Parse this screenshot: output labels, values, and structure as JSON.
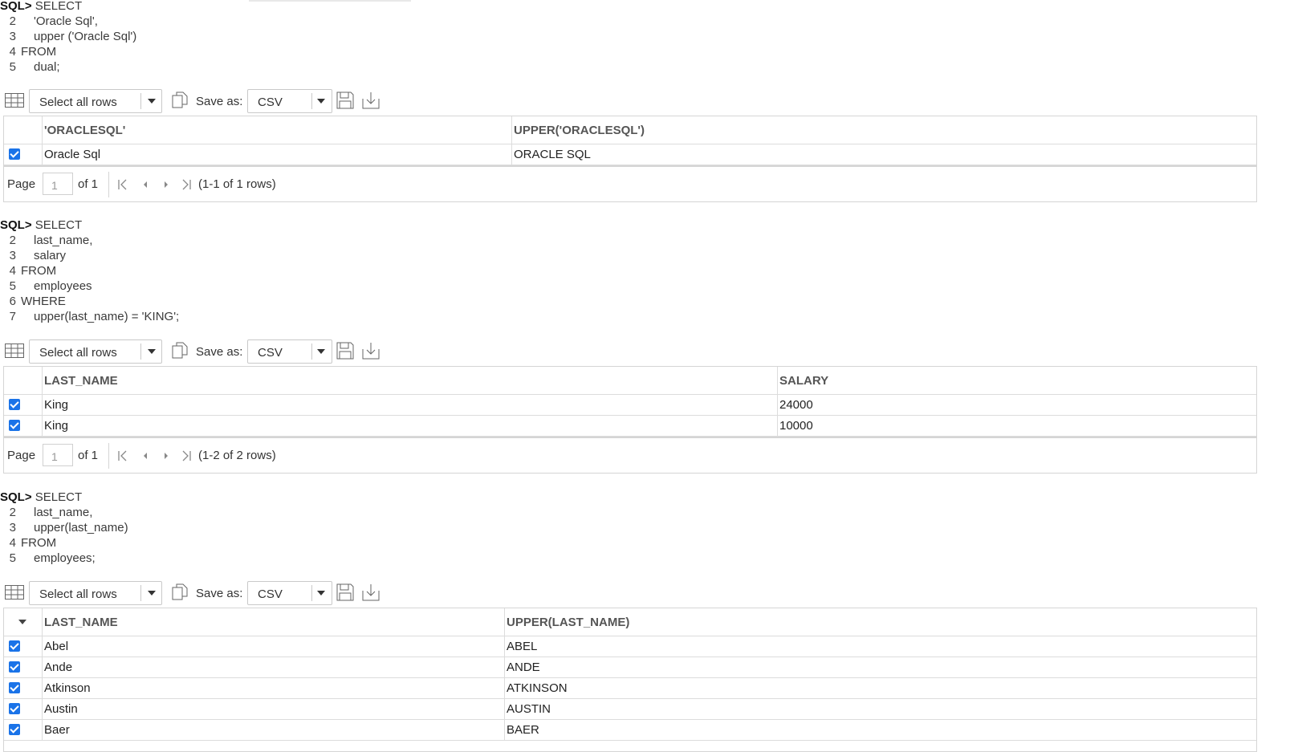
{
  "toolbar": {
    "select_label": "Select all rows",
    "save_as_label": "Save as:",
    "format_value": "CSV"
  },
  "pager": {
    "page_label": "Page",
    "of_label": "of 1",
    "page_value": "1"
  },
  "query1": {
    "prompt": "SQL>",
    "lines": [
      {
        "num": "",
        "text": "SELECT"
      },
      {
        "num": "2",
        "text": "'Oracle Sql',"
      },
      {
        "num": "3",
        "text": "upper ('Oracle Sql')"
      },
      {
        "num": "4",
        "text": "FROM"
      },
      {
        "num": "5",
        "text": "dual;"
      }
    ],
    "columns": [
      "'ORACLESQL'",
      "UPPER('ORACLESQL')"
    ],
    "rows": [
      [
        "Oracle Sql",
        "ORACLE SQL"
      ]
    ],
    "row_info": "(1-1 of 1 rows)"
  },
  "query2": {
    "prompt": "SQL>",
    "lines": [
      {
        "num": "",
        "text": "SELECT"
      },
      {
        "num": "2",
        "text": "last_name,"
      },
      {
        "num": "3",
        "text": "salary"
      },
      {
        "num": "4",
        "text": "FROM"
      },
      {
        "num": "5",
        "text": "employees"
      },
      {
        "num": "6",
        "text": "WHERE"
      },
      {
        "num": "7",
        "text": "upper(last_name) = 'KING';"
      }
    ],
    "columns": [
      "LAST_NAME",
      "SALARY"
    ],
    "rows": [
      [
        "King",
        "24000"
      ],
      [
        "King",
        "10000"
      ]
    ],
    "row_info": "(1-2 of 2 rows)"
  },
  "query3": {
    "prompt": "SQL>",
    "lines": [
      {
        "num": "",
        "text": "SELECT"
      },
      {
        "num": "2",
        "text": "last_name,"
      },
      {
        "num": "3",
        "text": "upper(last_name)"
      },
      {
        "num": "4",
        "text": "FROM"
      },
      {
        "num": "5",
        "text": "employees;"
      }
    ],
    "columns": [
      "LAST_NAME",
      "UPPER(LAST_NAME)"
    ],
    "rows": [
      [
        "Abel",
        "ABEL"
      ],
      [
        "Ande",
        "ANDE"
      ],
      [
        "Atkinson",
        "ATKINSON"
      ],
      [
        "Austin",
        "AUSTIN"
      ],
      [
        "Baer",
        "BAER"
      ]
    ]
  },
  "colors": {
    "checkbox": "#1a73e8",
    "border": "#d5d5d5"
  },
  "icons": [
    "grid-icon",
    "chevron-down-icon",
    "copy-icon",
    "save-icon",
    "download-icon",
    "first-page-icon",
    "prev-page-icon",
    "next-page-icon",
    "last-page-icon",
    "checkbox-checked-icon"
  ]
}
